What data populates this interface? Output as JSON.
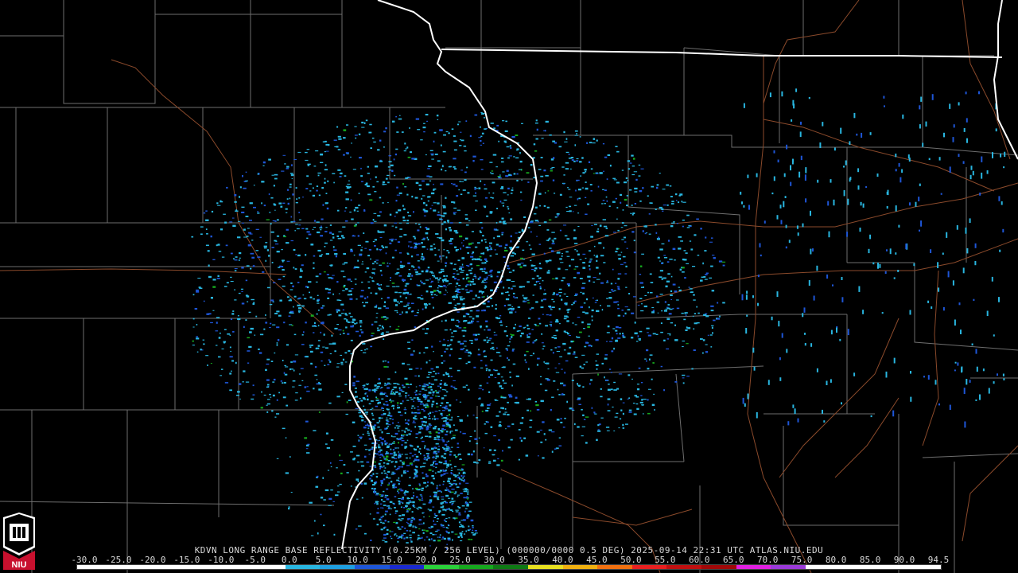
{
  "product_caption": "KDVN LONG RANGE BASE REFLECTIVITY (0.25KM / 256 LEVEL) (000000/0000 0.5 DEG) 2025-09-14 22:31 UTC  ATLAS.NIU.EDU",
  "colorbar": {
    "tick_labels": [
      "-30.0",
      "-25.0",
      "-20.0",
      "-15.0",
      "-10.0",
      "-5.0",
      "0.0",
      "5.0",
      "10.0",
      "15.0",
      "20.0",
      "25.0",
      "30.0",
      "35.0",
      "40.0",
      "45.0",
      "50.0",
      "55.0",
      "60.0",
      "65.0",
      "70.0",
      "75.0",
      "80.0",
      "85.0",
      "90.0",
      "94.5"
    ],
    "segments": [
      {
        "from": -30,
        "to": 0,
        "color": "#ffffff"
      },
      {
        "from": 0,
        "to": 5,
        "color": "#29b6e0"
      },
      {
        "from": 5,
        "to": 10,
        "color": "#1f9fe0"
      },
      {
        "from": 10,
        "to": 15,
        "color": "#1e56d8"
      },
      {
        "from": 15,
        "to": 20,
        "color": "#1a2ad0"
      },
      {
        "from": 20,
        "to": 25,
        "color": "#2ad03a"
      },
      {
        "from": 25,
        "to": 30,
        "color": "#16a81e"
      },
      {
        "from": 30,
        "to": 35,
        "color": "#0e7a14"
      },
      {
        "from": 35,
        "to": 40,
        "color": "#e8e020"
      },
      {
        "from": 40,
        "to": 45,
        "color": "#f0b010"
      },
      {
        "from": 45,
        "to": 50,
        "color": "#f07010"
      },
      {
        "from": 50,
        "to": 55,
        "color": "#e82020"
      },
      {
        "from": 55,
        "to": 60,
        "color": "#c01010"
      },
      {
        "from": 60,
        "to": 65,
        "color": "#a00808"
      },
      {
        "from": 65,
        "to": 70,
        "color": "#e020e0"
      },
      {
        "from": 70,
        "to": 75,
        "color": "#9a3ad8"
      },
      {
        "from": 75,
        "to": 80,
        "color": "#ffffff"
      },
      {
        "from": 80,
        "to": 94.5,
        "color": "#ffffff"
      }
    ]
  },
  "logo": {
    "text": "NIU",
    "color": "#c8102e"
  },
  "map_colors": {
    "background": "#000000",
    "county_lines": "#6e6e6e",
    "state_lines": "#ffffff",
    "highways": "#8b4a2b",
    "echo_light": "#29b6e0",
    "echo_mid": "#1e56d8",
    "echo_strong": "#16a81e"
  }
}
